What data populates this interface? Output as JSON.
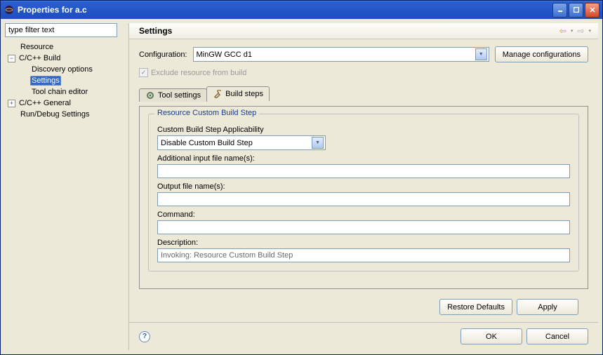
{
  "window": {
    "title": "Properties for a.c"
  },
  "sidebar": {
    "filter_placeholder": "type filter text",
    "items": {
      "resource": "Resource",
      "cbuild": "C/C++ Build",
      "discovery": "Discovery options",
      "settings": "Settings",
      "toolchain": "Tool chain editor",
      "cgeneral": "C/C++ General",
      "rundebug": "Run/Debug Settings"
    }
  },
  "main": {
    "heading": "Settings",
    "config_label": "Configuration:",
    "config_value": "MinGW GCC d1",
    "manage_btn": "Manage configurations",
    "exclude_label": "Exclude resource from build",
    "tabs": {
      "tool": "Tool settings",
      "build": "Build steps"
    },
    "group": {
      "title": "Resource Custom Build Step",
      "applicability_label": "Custom Build Step Applicability",
      "applicability_value": "Disable Custom Build Step",
      "inputs_label": "Additional input file name(s):",
      "inputs_value": "",
      "outputs_label": "Output file name(s):",
      "outputs_value": "",
      "command_label": "Command:",
      "command_value": "",
      "description_label": "Description:",
      "description_value": "Invoking: Resource Custom Build Step"
    },
    "restore_btn": "Restore Defaults",
    "apply_btn": "Apply"
  },
  "footer": {
    "ok": "OK",
    "cancel": "Cancel"
  }
}
